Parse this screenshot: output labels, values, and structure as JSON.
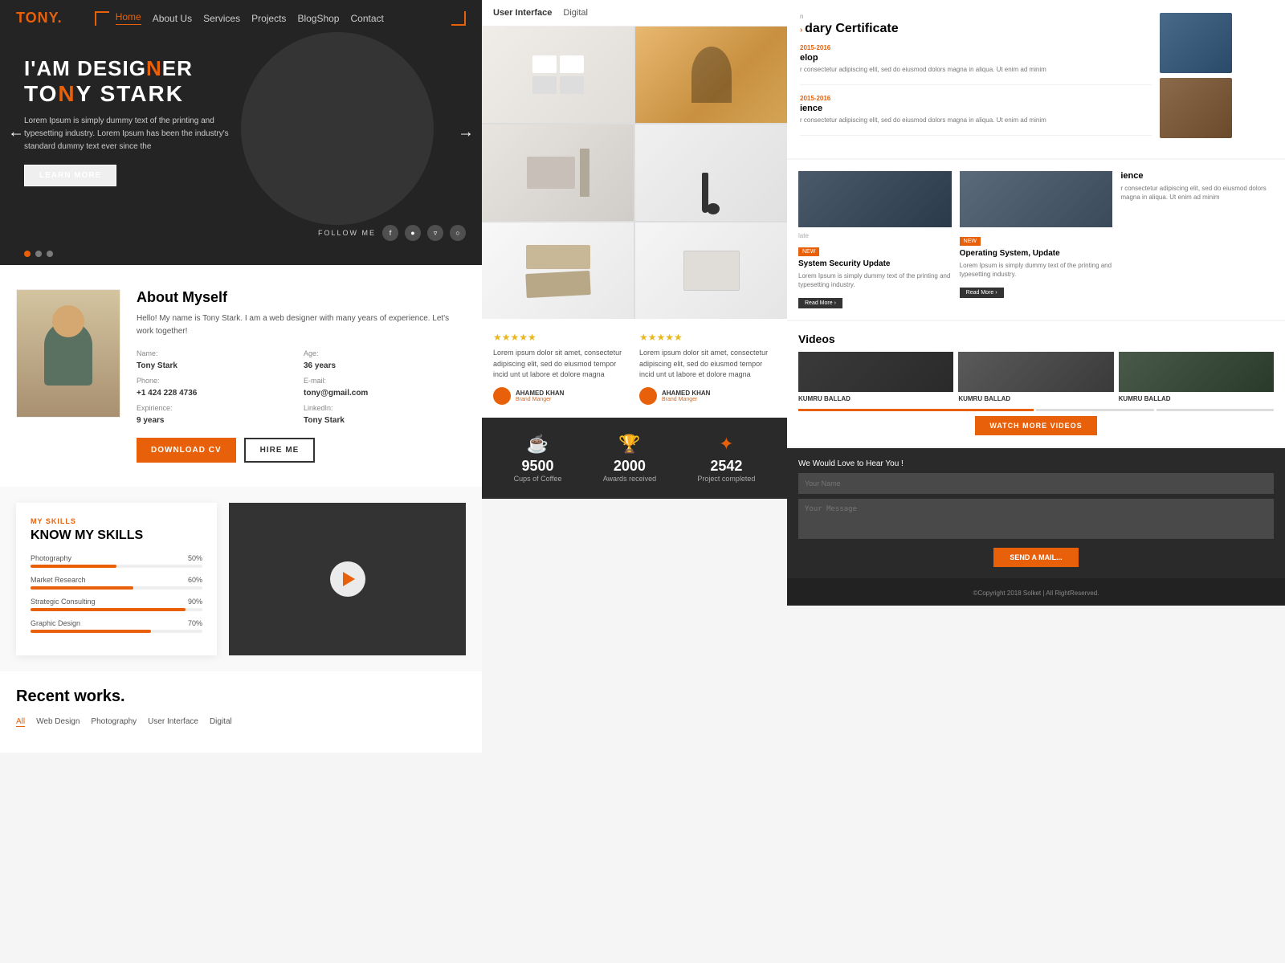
{
  "brand": {
    "logo": "TONY.",
    "logo_accent": "."
  },
  "nav": {
    "items": [
      {
        "label": "Home",
        "active": true
      },
      {
        "label": "About Us",
        "active": false
      },
      {
        "label": "Services",
        "active": false
      },
      {
        "label": "Projects",
        "active": false
      },
      {
        "label": "BlogShop",
        "active": false
      },
      {
        "label": "Contact",
        "active": false
      }
    ]
  },
  "hero": {
    "line1": "I'AM DESIGNER",
    "line1_highlight": "N",
    "line2_prefix": "TO",
    "line2_highlight": "N",
    "line2_suffix": "Y STARK",
    "description": "Lorem Ipsum is simply dummy text of the printing and typesetting industry. Lorem Ipsum has been the industry's standard dummy text ever since the",
    "cta": "LEARN MORE",
    "follow_label": "FOLLOW ME",
    "dots": [
      true,
      false,
      false
    ]
  },
  "about": {
    "title": "About Myself",
    "description": "Hello! My name is Tony Stark. I am a web designer with many years of experience. Let's work together!",
    "fields": {
      "name_label": "Name:",
      "name_value": "Tony Stark",
      "age_label": "Age:",
      "age_value": "36 years",
      "phone_label": "Phone:",
      "phone_value": "+1 424 228 4736",
      "email_label": "E-mail:",
      "email_value": "tony@gmail.com",
      "experience_label": "Expirience:",
      "experience_value": "9 years",
      "linkedin_label": "LinkedIn:",
      "linkedin_value": "Tony Stark"
    },
    "btn_download": "DOWNLOAD CV",
    "btn_hire": "HIRE ME"
  },
  "skills": {
    "section_label": "MY SKILLS",
    "title": "KNOW MY SKILLS",
    "items": [
      {
        "name": "Photography",
        "percent": 50
      },
      {
        "name": "Market Research",
        "percent": 60
      },
      {
        "name": "Strategic Consulting",
        "percent": 90
      },
      {
        "name": "Graphic Design",
        "percent": 70
      }
    ]
  },
  "portfolio": {
    "nav_items": [
      "User Interface",
      "Digital"
    ],
    "filters": [
      "All",
      "Web Design",
      "Photography",
      "User Interface",
      "Digital"
    ]
  },
  "recent_works": {
    "title": "Recent works.",
    "filters": [
      "All",
      "Web Design",
      "Photography",
      "User Interface",
      "Digital"
    ]
  },
  "stats": [
    {
      "icon": "☕",
      "number": "9500",
      "label": "Cups of Coffee"
    },
    {
      "icon": "🏆",
      "number": "2000",
      "label": "Awards received"
    },
    {
      "icon": "✦",
      "number": "2542",
      "label": "Project completed"
    }
  ],
  "testimonials": [
    {
      "stars": "★★★★★",
      "text": "Lorem ipsum dolor sit amet, consectetur adipiscing elit, sed do eiusmod tempor incid unt ut labore et dolore magna",
      "author": "AHAMED KHAN",
      "role": "Brand Manger"
    },
    {
      "stars": "★★★★★",
      "text": "Lorem ipsum dolor sit amet, consectetur adipiscing elit, sed do eiusmod tempor incid unt ut labore et dolore magna",
      "author": "AHAMED KHAN",
      "role": "Brand Manger"
    }
  ],
  "certificates": {
    "header": "dary Certificate",
    "items": [
      {
        "date": "2015-2016",
        "title": "elop",
        "desc": "r consectetur adipiscing elit, sed do eiusmod\ndolors magna in aliqua. Ut enim ad minim"
      },
      {
        "date": "2015-2016",
        "title": "ience",
        "desc": "r consectetur adipiscing elit, sed do eiusmod\ndolors magna in aliqua. Ut enim ad minim"
      }
    ]
  },
  "blog": {
    "section_label": "Videos",
    "posts": [
      {
        "badge": "NEW",
        "title": "System Security Update",
        "desc": "Lorem Ipsum is simply dummy text of the printing and typesetting industry."
      },
      {
        "badge": "NEW",
        "title": "Operating System, Update",
        "desc": "Lorem Ipsum is simply dummy text of the printing and typesetting industry."
      }
    ],
    "read_more": "Read More ›"
  },
  "videos": {
    "section_label": "Videos",
    "thumbnails": [
      {
        "label": "KUMRU BALLAD"
      },
      {
        "label": "KUMRU BALLAD"
      },
      {
        "label": "KUMRU BALLAD"
      }
    ],
    "watch_more": "WATCH MORE VIDEOS"
  },
  "contact": {
    "title": "We Would Love to Hear You !",
    "name_placeholder": "Your Name",
    "message_placeholder": "Your Message",
    "send_btn": "SEND A MAIL..."
  },
  "footer": {
    "text": "©Copyright 2018 Solket | All RightReserved."
  }
}
